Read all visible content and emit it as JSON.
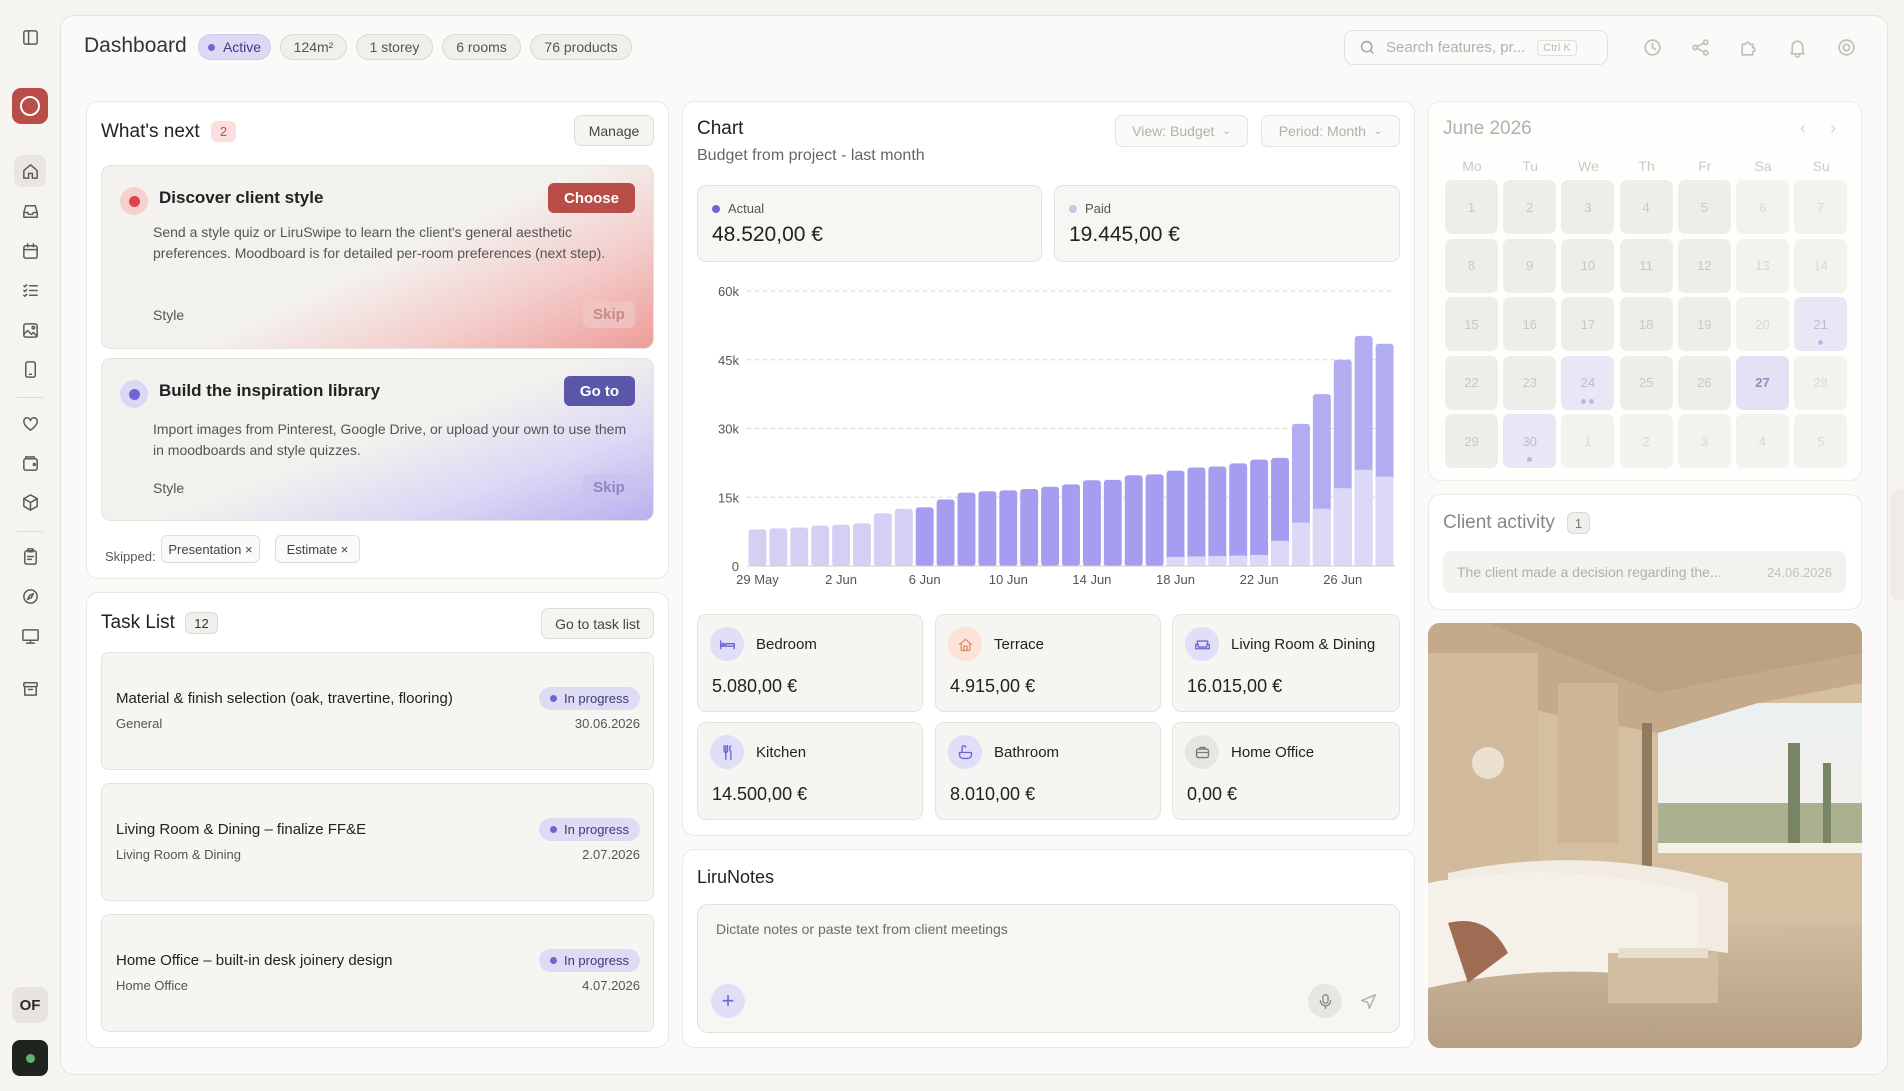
{
  "header": {
    "title": "Dashboard",
    "chips": [
      "Active",
      "124m²",
      "1 storey",
      "6 rooms",
      "76 products"
    ],
    "search_placeholder": "Search features, pr...",
    "search_shortcut": "Ctrl K"
  },
  "sidebar": {
    "avatar": "OF",
    "icons": [
      "sidebar-toggle-icon",
      "home-icon",
      "inbox-icon",
      "calendar-icon",
      "checklist-icon",
      "image-icon",
      "tablet-icon",
      "heart-icon",
      "wallet-icon",
      "box-icon",
      "clipboard-icon",
      "compass-icon",
      "presentation-icon",
      "archive-icon"
    ]
  },
  "whats_next": {
    "title": "What's next",
    "count": "2",
    "manage": "Manage",
    "steps": [
      {
        "title": "Discover client style",
        "action": "Choose",
        "desc": "Send a style quiz or LiruSwipe to learn the client's general aesthetic preferences. Moodboard is for detailed per-room preferences (next step).",
        "tag": "Style",
        "skip": "Skip",
        "accent": "#b84e47"
      },
      {
        "title": "Build the inspiration library",
        "action": "Go to",
        "desc": "Import images from Pinterest, Google Drive, or upload your own to use them in moodboards and style quizzes.",
        "tag": "Style",
        "skip": "Skip",
        "accent": "#5a56a8"
      }
    ],
    "skipped_label": "Skipped:",
    "skipped": [
      "Presentation ×",
      "Estimate ×"
    ]
  },
  "tasks": {
    "title": "Task List",
    "count": "12",
    "go_to": "Go to task list",
    "items": [
      {
        "title": "Material & finish selection (oak, travertine, flooring)",
        "category": "General",
        "status": "In progress",
        "date": "30.06.2026"
      },
      {
        "title": "Living Room & Dining – finalize FF&E",
        "category": "Living Room & Dining",
        "status": "In progress",
        "date": "2.07.2026"
      },
      {
        "title": "Home Office – built-in desk joinery design",
        "category": "Home Office",
        "status": "In progress",
        "date": "4.07.2026"
      }
    ]
  },
  "chart": {
    "title": "Chart",
    "subtitle": "Budget from project - last month",
    "view": "View: Budget",
    "period": "Period: Month",
    "actual_label": "Actual",
    "actual_value": "48.520,00 €",
    "paid_label": "Paid",
    "paid_value": "19.445,00 €",
    "colors": {
      "actual": "#a9a3ec",
      "paid": "#d8d5f7"
    }
  },
  "chart_data": {
    "type": "bar",
    "title": "",
    "xlabel": "",
    "ylabel": "",
    "ylim": [
      0,
      60000
    ],
    "yticks": [
      "60k",
      "45k",
      "30k",
      "15k",
      "0"
    ],
    "x_tick_labels": [
      "29 May",
      "2 Jun",
      "6 Jun",
      "10 Jun",
      "14 Jun",
      "18 Jun",
      "22 Jun",
      "26 Jun"
    ],
    "categories": [
      "29 May",
      "30 May",
      "31 May",
      "1 Jun",
      "2 Jun",
      "3 Jun",
      "4 Jun",
      "5 Jun",
      "6 Jun",
      "7 Jun",
      "8 Jun",
      "9 Jun",
      "10 Jun",
      "11 Jun",
      "12 Jun",
      "13 Jun",
      "14 Jun",
      "15 Jun",
      "16 Jun",
      "17 Jun",
      "18 Jun",
      "19 Jun",
      "20 Jun",
      "21 Jun",
      "22 Jun",
      "23 Jun",
      "24 Jun",
      "25 Jun",
      "26 Jun",
      "27 Jun",
      "28 Jun"
    ],
    "series": [
      {
        "name": "Actual",
        "values": [
          8000,
          8200,
          8400,
          8800,
          9000,
          9300,
          11500,
          12500,
          12800,
          14500,
          16000,
          16300,
          16500,
          16800,
          17300,
          17800,
          18700,
          18800,
          19800,
          20000,
          20800,
          21500,
          21700,
          22400,
          23200,
          23600,
          31000,
          37500,
          45000,
          50200,
          48500
        ]
      },
      {
        "name": "Paid",
        "values": [
          0,
          0,
          0,
          0,
          0,
          0,
          0,
          0,
          0,
          0,
          0,
          0,
          0,
          0,
          0,
          0,
          0,
          0,
          0,
          0,
          2000,
          2100,
          2200,
          2300,
          2400,
          5500,
          9500,
          12500,
          17000,
          21000,
          19500
        ]
      }
    ]
  },
  "rooms": [
    {
      "name": "Bedroom",
      "value": "5.080,00 €",
      "icon": "bed-icon"
    },
    {
      "name": "Terrace",
      "value": "4.915,00 €",
      "icon": "house-icon"
    },
    {
      "name": "Living Room & Dining",
      "value": "16.015,00 €",
      "icon": "sofa-icon"
    },
    {
      "name": "Kitchen",
      "value": "14.500,00 €",
      "icon": "utensils-icon"
    },
    {
      "name": "Bathroom",
      "value": "8.010,00 €",
      "icon": "bath-icon"
    },
    {
      "name": "Home Office",
      "value": "0,00 €",
      "icon": "briefcase-icon"
    }
  ],
  "notes": {
    "title": "LiruNotes",
    "placeholder": "Dictate notes or paste text from client meetings"
  },
  "calendar": {
    "title": "June 2026",
    "days": [
      "Mo",
      "Tu",
      "We",
      "Th",
      "Fr",
      "Sa",
      "Su"
    ],
    "cells": [
      "1",
      "2",
      "3",
      "4",
      "5",
      "6",
      "7",
      "8",
      "9",
      "10",
      "11",
      "12",
      "13",
      "14",
      "15",
      "16",
      "17",
      "18",
      "19",
      "20",
      "21",
      "22",
      "23",
      "24",
      "25",
      "26",
      "27",
      "28",
      "29",
      "30",
      "1",
      "2",
      "3",
      "4",
      "5"
    ]
  },
  "client_activity": {
    "title": "Client activity",
    "count": "1",
    "text": "The client made a decision regarding the...",
    "date": "24.06.2026"
  }
}
